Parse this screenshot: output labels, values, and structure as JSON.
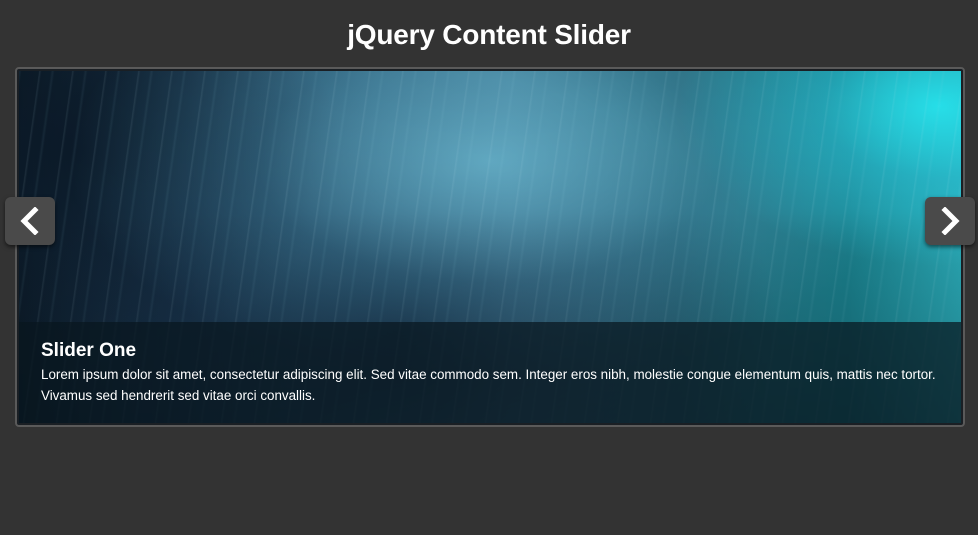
{
  "page": {
    "title": "jQuery Content Slider"
  },
  "slider": {
    "slides": [
      {
        "title": "Slider One",
        "text": "Lorem ipsum dolor sit amet, consectetur adipiscing elit. Sed vitae commodo sem. Integer eros nibh, molestie congue elementum quis, mattis nec tortor. Vivamus sed hendrerit sed vitae orci convallis."
      }
    ],
    "controls": {
      "prev_icon": "chevron-left-icon",
      "next_icon": "chevron-right-icon"
    }
  },
  "colors": {
    "background": "#333333",
    "button": "#4a4a4a",
    "frame_border": "#5a5a5a",
    "text": "#ffffff"
  }
}
